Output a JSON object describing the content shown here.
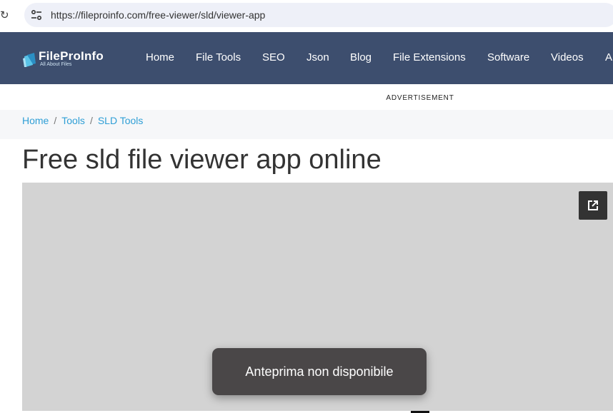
{
  "browser": {
    "url": "https://fileproinfo.com/free-viewer/sld/viewer-app",
    "reload_icon": "reload-icon",
    "site_info_icon": "tune-icon"
  },
  "site": {
    "logo_name": "FileProInfo",
    "logo_tagline": "All About Files",
    "nav": [
      "Home",
      "File Tools",
      "SEO",
      "Json",
      "Blog",
      "File Extensions",
      "Software",
      "Videos",
      "A"
    ],
    "nav_color": "#3d4e6e"
  },
  "advertisement": "ADVERTISEMENT",
  "breadcrumb": [
    "Home",
    "Tools",
    "SLD Tools"
  ],
  "breadcrumb_separator": "/",
  "page_title": "Free sld file viewer app online",
  "viewer": {
    "popout_icon": "open-in-new-icon",
    "toast": "Anteprima non disponibile"
  }
}
